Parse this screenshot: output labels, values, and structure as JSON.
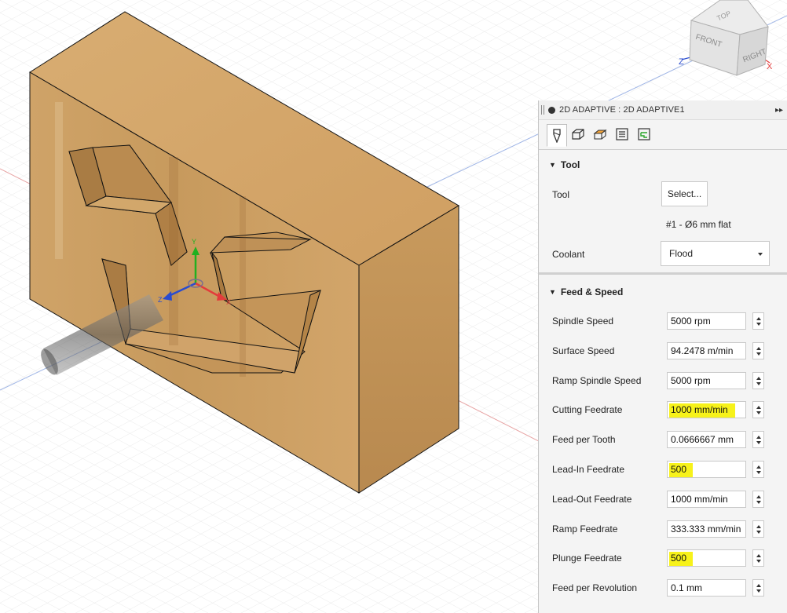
{
  "viewcube": {
    "top": "TOP",
    "front": "FRONT",
    "right": "RIGHT",
    "axis_z": "Z",
    "axis_x": "X"
  },
  "gizmo": {
    "x": "X",
    "y": "Y",
    "z": "Z"
  },
  "colors": {
    "wood_front": "#c99d60",
    "wood_top": "#d7aa70",
    "wood_side": "#b8894f",
    "highlight": "#f7f21a",
    "x_axis": "#e33b3b",
    "y_axis": "#20b020",
    "z_axis": "#2a4ccf"
  },
  "panel": {
    "title": "2D ADAPTIVE : 2D ADAPTIVE1",
    "expand_icon": "double-chevron-right",
    "tabs": [
      "tool-tab-icon",
      "geometry-tab-icon",
      "heights-tab-icon",
      "passes-tab-icon",
      "linking-tab-icon"
    ],
    "tool_section": {
      "heading": "Tool",
      "tool_label": "Tool",
      "select_button": "Select...",
      "tool_description": "#1 - Ø6 mm flat",
      "coolant_label": "Coolant",
      "coolant_value": "Flood"
    },
    "feed_section": {
      "heading": "Feed & Speed",
      "rows": [
        {
          "label": "Spindle Speed",
          "value": "5000 rpm",
          "highlighted": false
        },
        {
          "label": "Surface Speed",
          "value": "94.2478 m/min",
          "highlighted": false
        },
        {
          "label": "Ramp Spindle Speed",
          "value": "5000 rpm",
          "highlighted": false
        },
        {
          "label": "Cutting Feedrate",
          "value": "1000 mm/min",
          "highlighted": true
        },
        {
          "label": "Feed per Tooth",
          "value": "0.0666667 mm",
          "highlighted": false
        },
        {
          "label": "Lead-In Feedrate",
          "value": "500",
          "highlighted": true
        },
        {
          "label": "Lead-Out Feedrate",
          "value": "1000 mm/min",
          "highlighted": false
        },
        {
          "label": "Ramp Feedrate",
          "value": "333.333 mm/min",
          "highlighted": false
        },
        {
          "label": "Plunge Feedrate",
          "value": "500",
          "highlighted": true
        },
        {
          "label": "Feed per Revolution",
          "value": "0.1 mm",
          "highlighted": false
        }
      ]
    }
  }
}
